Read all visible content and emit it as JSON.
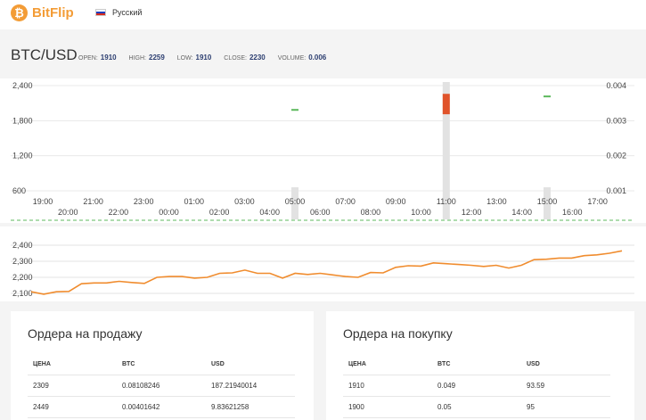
{
  "brand": {
    "name": "BitFlip",
    "logo_glyph": "₿",
    "accent": "#f39c36"
  },
  "language": {
    "label": "Русский"
  },
  "market": {
    "pair": "BTC/USD",
    "stats": [
      {
        "label": "OPEN:",
        "value": "1910"
      },
      {
        "label": "HIGH:",
        "value": "2259"
      },
      {
        "label": "LOW:",
        "value": "1910"
      },
      {
        "label": "CLOSE:",
        "value": "2230"
      },
      {
        "label": "VOLUME:",
        "value": "0.006"
      }
    ]
  },
  "chart_data": [
    {
      "type": "bar",
      "left_axis": {
        "ticks": [
          "2,400",
          "1,800",
          "1,200",
          "600"
        ],
        "range": [
          600,
          2400
        ]
      },
      "right_axis": {
        "ticks": [
          "0.004",
          "0.003",
          "0.002",
          "0.001"
        ],
        "range": [
          0.001,
          0.004
        ]
      },
      "time_labels_top": [
        "19:00",
        "21:00",
        "23:00",
        "01:00",
        "03:00",
        "05:00",
        "07:00",
        "09:00",
        "11:00",
        "13:00",
        "15:00",
        "17:00"
      ],
      "time_labels_bottom": [
        "20:00",
        "22:00",
        "00:00",
        "02:00",
        "04:00",
        "06:00",
        "08:00",
        "10:00",
        "12:00",
        "14:00",
        "16:00"
      ],
      "candles": [
        {
          "time": "05:00",
          "open": 2000,
          "close": 2000,
          "volume": 0.001,
          "color": "#5cb85c"
        },
        {
          "time": "11:00",
          "open": 2259,
          "close": 1910,
          "volume": 0.004,
          "color": "#e0532a"
        },
        {
          "time": "15:00",
          "open": 2230,
          "close": 2230,
          "volume": 0.001,
          "color": "#5cb85c"
        }
      ]
    },
    {
      "type": "line",
      "y_axis": {
        "ticks": [
          "2,400",
          "2,300",
          "2,200",
          "2,100"
        ],
        "range": [
          2050,
          2450
        ]
      },
      "series": [
        {
          "color": "#f08c2e",
          "values": [
            2110,
            2095,
            2110,
            2112,
            2160,
            2165,
            2165,
            2175,
            2168,
            2162,
            2200,
            2205,
            2205,
            2195,
            2200,
            2225,
            2228,
            2245,
            2225,
            2225,
            2195,
            2225,
            2218,
            2225,
            2215,
            2205,
            2200,
            2230,
            2228,
            2262,
            2272,
            2270,
            2290,
            2285,
            2280,
            2275,
            2268,
            2275,
            2258,
            2275,
            2310,
            2313,
            2320,
            2320,
            2335,
            2340,
            2350,
            2365
          ]
        }
      ]
    }
  ],
  "sell_orders": {
    "title": "Ордера на продажу",
    "headers": [
      "ЦЕНА",
      "BTC",
      "USD"
    ],
    "rows": [
      [
        "2309",
        "0.08108246",
        "187.21940014"
      ],
      [
        "2449",
        "0.00401642",
        "9.83621258"
      ]
    ]
  },
  "buy_orders": {
    "title": "Ордера на покупку",
    "headers": [
      "ЦЕНА",
      "BTC",
      "USD"
    ],
    "rows": [
      [
        "1910",
        "0.049",
        "93.59"
      ],
      [
        "1900",
        "0.05",
        "95"
      ]
    ]
  }
}
